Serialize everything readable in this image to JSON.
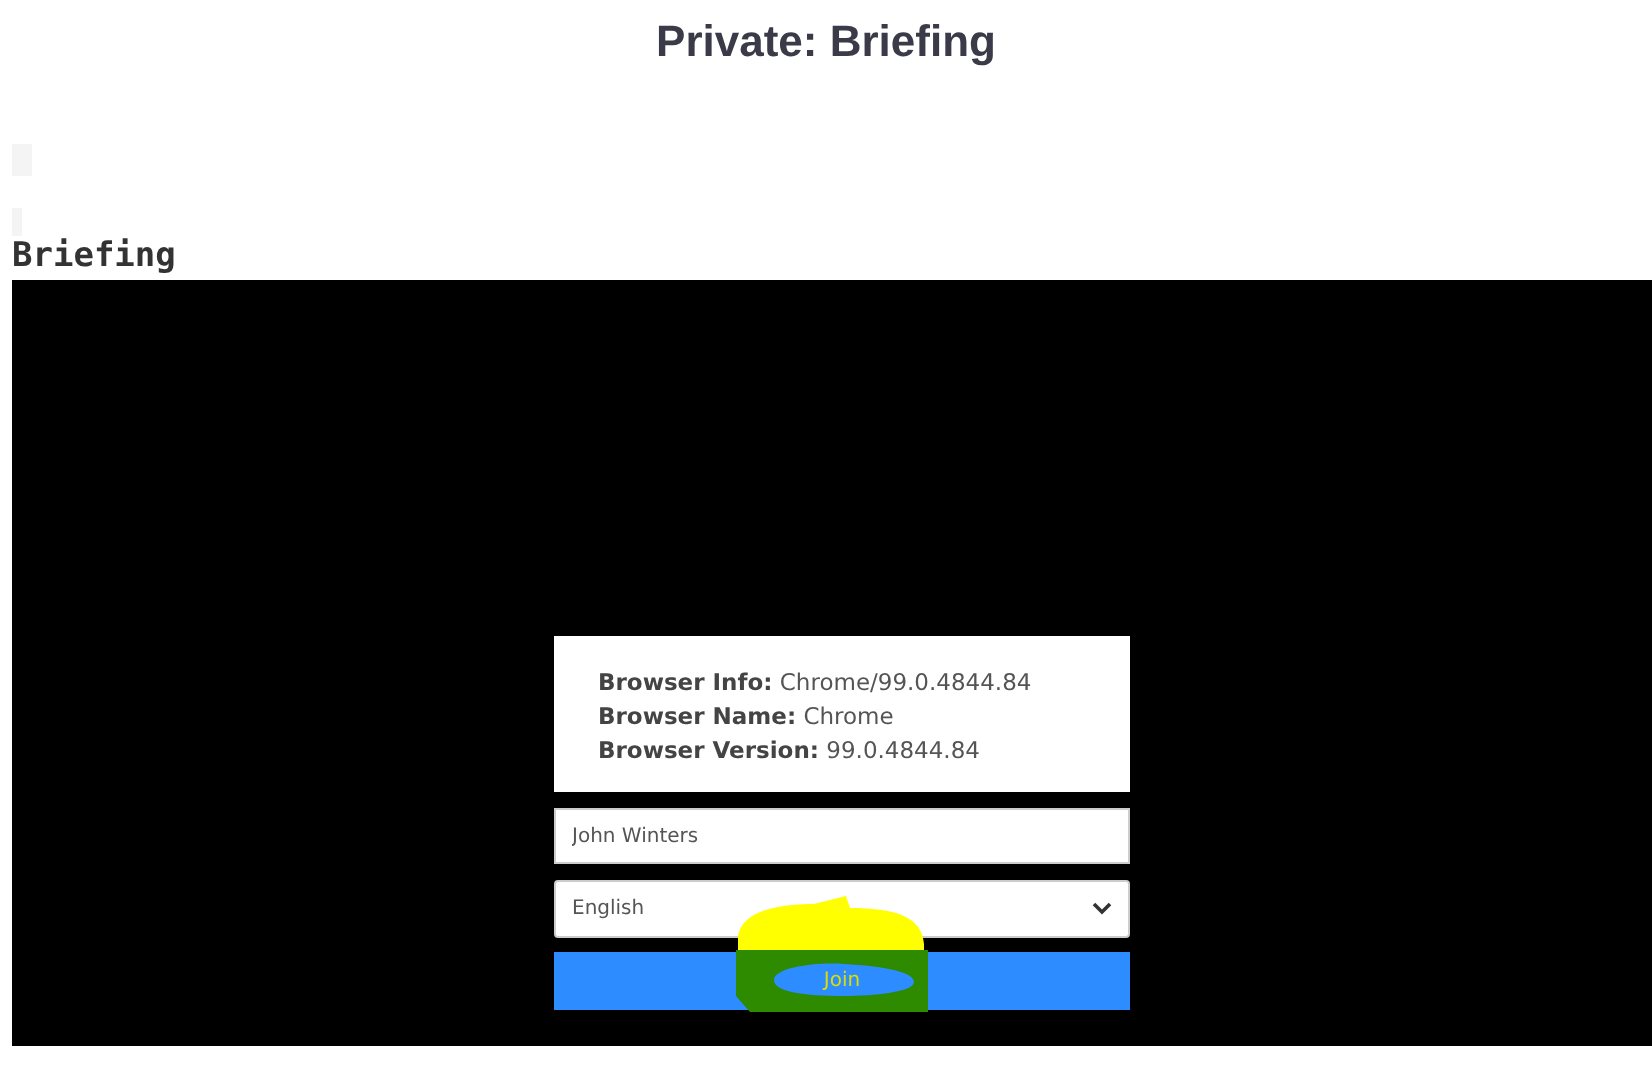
{
  "page_title": "Private: Briefing",
  "heading": "Briefing",
  "browser_info": [
    {
      "label": "Browser Info:",
      "value": "Chrome/99.0.4844.84"
    },
    {
      "label": "Browser Name:",
      "value": "Chrome"
    },
    {
      "label": "Browser Version:",
      "value": "99.0.4844.84"
    }
  ],
  "name_field": {
    "value": "John Winters"
  },
  "language_select": {
    "value": "English"
  },
  "join_button": {
    "label": "Join"
  }
}
